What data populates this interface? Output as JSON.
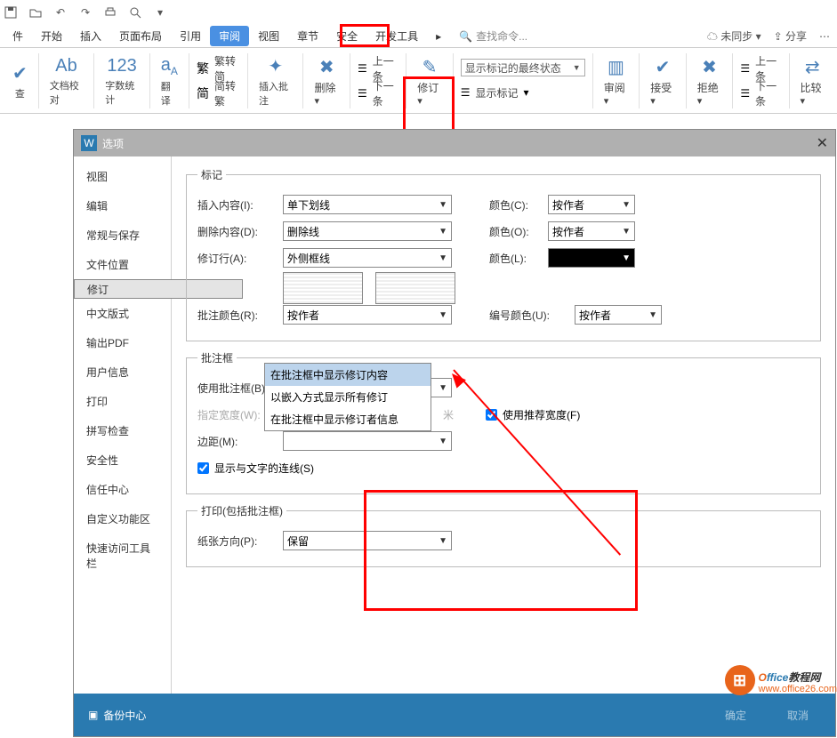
{
  "qat_icons": [
    "save-icon",
    "undo-icon",
    "redo-icon",
    "print-icon",
    "preview-icon",
    "more-icon"
  ],
  "menu": {
    "items": [
      "件",
      "开始",
      "插入",
      "页面布局",
      "引用",
      "审阅",
      "视图",
      "章节",
      "安全",
      "开发工具"
    ],
    "active_idx": 5,
    "search_placeholder": "查找命令...",
    "right": [
      "未同步",
      "分享"
    ]
  },
  "ribbon": {
    "g1": {
      "btn1": "查",
      "btn2": "文档校对"
    },
    "g2": {
      "btn": "字数统计"
    },
    "g3": {
      "btn": "翻译"
    },
    "g4": {
      "l1": "繁转简",
      "l2": "简转繁"
    },
    "g5": {
      "btn": "插入批注"
    },
    "g6": {
      "btn": "删除"
    },
    "g7": {
      "l1": "上一条",
      "l2": "下一条"
    },
    "g8": {
      "btn": "修订"
    },
    "g9": {
      "combo": "显示标记的最终状态",
      "l2": "显示标记"
    },
    "g10": {
      "btn": "审阅"
    },
    "g11": {
      "btn": "接受"
    },
    "g12": {
      "btn": "拒绝"
    },
    "g13": {
      "l1": "上一条",
      "l2": "下一条"
    },
    "g14": {
      "btn": "比较"
    }
  },
  "dialog": {
    "title": "选项",
    "sidebar": [
      "视图",
      "编辑",
      "常规与保存",
      "文件位置",
      "修订",
      "中文版式",
      "输出PDF",
      "用户信息",
      "打印",
      "拼写检查",
      "安全性",
      "信任中心",
      "自定义功能区",
      "快速访问工具栏"
    ],
    "sidebar_sel": 4,
    "mark": {
      "legend": "标记",
      "insert_lab": "插入内容(I):",
      "insert_val": "单下划线",
      "color_c": "颜色(C):",
      "by_author": "按作者",
      "delete_lab": "删除内容(D):",
      "delete_val": "删除线",
      "color_o": "颜色(O):",
      "line_lab": "修订行(A):",
      "line_val": "外侧框线",
      "color_l": "颜色(L):",
      "anno_lab": "批注颜色(R):",
      "anno_val": "按作者",
      "num_lab": "编号颜色(U):"
    },
    "balloon": {
      "legend": "批注框",
      "use_lab": "使用批注框(B):",
      "use_val": "在批注框中显示修订内容",
      "opts": [
        "在批注框中显示修订内容",
        "以嵌入方式显示所有修订",
        "在批注框中显示修订者信息"
      ],
      "width_lab": "指定宽度(W):",
      "width_unit": "米",
      "rec_lab": "使用推荐宽度(F)",
      "margin_lab": "边距(M):",
      "showline_lab": "显示与文字的连线(S)"
    },
    "print": {
      "legend": "打印(包括批注框)",
      "orient_lab": "纸张方向(P):",
      "orient_val": "保留"
    },
    "footer": {
      "backup": "备份中心",
      "ok": "确定",
      "cancel": "取消"
    }
  },
  "watermark": {
    "brand_a": "O",
    "brand_b": "ffice",
    "brand_c": "教程网",
    "url": "www.office26.com"
  }
}
